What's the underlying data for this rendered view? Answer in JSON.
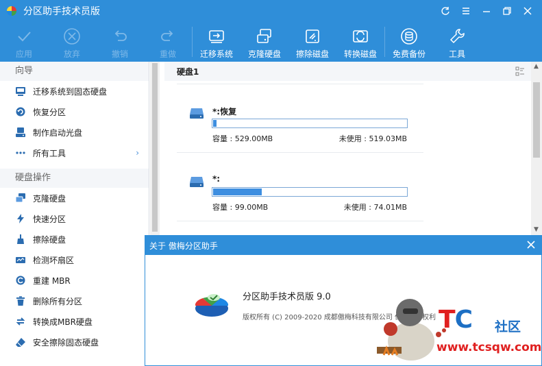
{
  "window": {
    "title": "分区助手技术员版"
  },
  "toolbar": {
    "items": [
      {
        "label": "应用",
        "icon": "check-icon",
        "enabled": false
      },
      {
        "label": "放弃",
        "icon": "cancel-icon",
        "enabled": false
      },
      {
        "label": "撤销",
        "icon": "undo-icon",
        "enabled": false
      },
      {
        "label": "重做",
        "icon": "redo-icon",
        "enabled": false
      },
      {
        "label": "迁移系统",
        "icon": "migrate-os-icon",
        "enabled": true
      },
      {
        "label": "克隆硬盘",
        "icon": "clone-disk-icon",
        "enabled": true
      },
      {
        "label": "擦除磁盘",
        "icon": "wipe-disk-icon",
        "enabled": true
      },
      {
        "label": "转换磁盘",
        "icon": "convert-disk-icon",
        "enabled": true
      },
      {
        "label": "免费备份",
        "icon": "backup-icon",
        "enabled": true
      },
      {
        "label": "工具",
        "icon": "tools-icon",
        "enabled": true
      }
    ]
  },
  "sidebar": {
    "wizard_title": "向导",
    "wizard_items": [
      {
        "label": "迁移系统到固态硬盘",
        "icon": "migrate-ssd-icon"
      },
      {
        "label": "恢复分区",
        "icon": "recover-partition-icon"
      },
      {
        "label": "制作启动光盘",
        "icon": "bootable-disc-icon"
      },
      {
        "label": "所有工具",
        "icon": "more-dots-icon",
        "chevron": "›"
      }
    ],
    "disk_ops_title": "硬盘操作",
    "disk_ops_items": [
      {
        "label": "克隆硬盘",
        "icon": "clone-icon"
      },
      {
        "label": "快速分区",
        "icon": "lightning-icon"
      },
      {
        "label": "擦除硬盘",
        "icon": "broom-icon"
      },
      {
        "label": "检测坏扇区",
        "icon": "bad-sector-icon"
      },
      {
        "label": "重建 MBR",
        "icon": "rebuild-mbr-icon"
      },
      {
        "label": "删除所有分区",
        "icon": "trash-icon"
      },
      {
        "label": "转换成MBR硬盘",
        "icon": "convert-icon"
      },
      {
        "label": "安全擦除固态硬盘",
        "icon": "eraser-icon"
      }
    ]
  },
  "main": {
    "disk_title": "硬盘1",
    "partitions": [
      {
        "name": "*:恢复",
        "capacity": "容量 : 529.00MB",
        "unused": "未使用 : 519.03MB",
        "used_fraction": 0.019
      },
      {
        "name": "*:",
        "capacity": "容量 : 99.00MB",
        "unused": "未使用 : 74.01MB",
        "used_fraction": 0.252
      }
    ]
  },
  "about_dialog": {
    "title": "关于 傲梅分区助手",
    "product": "分区助手技术员版 9.0",
    "copyright": "版权所有 (C) 2009-2020 成都傲梅科技有限公司 保留所有权利"
  },
  "watermark": {
    "brand_t": "T",
    "brand_c": "C",
    "suffix": "社区",
    "url": "www.tcsqw.com"
  },
  "colors": {
    "accent": "#2f8ed9",
    "bar_fill": "#3d8ee0",
    "watermark_red": "#e02020",
    "watermark_blue": "#1d6fc4"
  }
}
